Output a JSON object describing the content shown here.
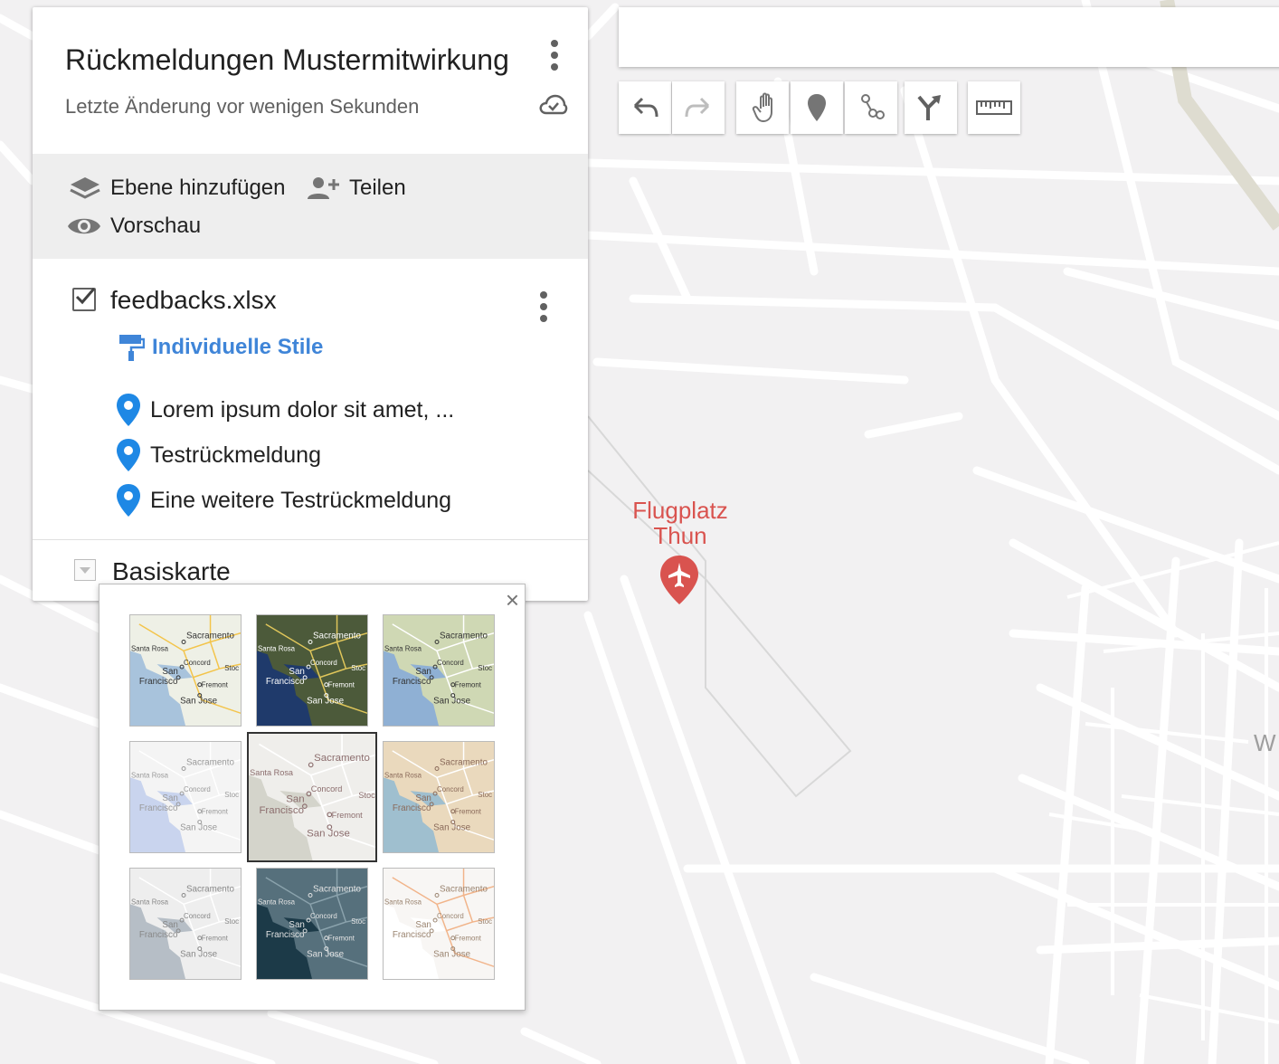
{
  "map": {
    "place_label": "Flugplatz\nThun",
    "place_label_line1": "Flugplatz",
    "place_label_line2": "Thun",
    "edge_label": "W",
    "colors": {
      "background": "#f2f1f2",
      "roads": "#ffffff",
      "airport_red": "#d9534f",
      "pin_blue": "#1e88e5"
    }
  },
  "panel": {
    "title": "Rückmeldungen Mustermitwirkung",
    "last_edit": "Letzte Änderung vor wenigen Sekunden",
    "actions": {
      "add_layer": "Ebene hinzufügen",
      "share": "Teilen",
      "preview": "Vorschau"
    },
    "layer": {
      "name": "feedbacks.xlsx",
      "checked": true,
      "styles_link": "Individuelle Stile",
      "features": [
        {
          "label": "Lorem ipsum dolor sit amet, ..."
        },
        {
          "label": "Testrückmeldung"
        },
        {
          "label": "Eine weitere Testrückmeldung"
        }
      ]
    },
    "basemap_label": "Basiskarte"
  },
  "toolbar": {
    "tools": [
      "undo-icon",
      "redo-icon",
      "hand-icon",
      "marker-icon",
      "line-icon",
      "directions-icon",
      "ruler-icon"
    ]
  },
  "basemap_popup": {
    "close_label": "×",
    "selected_index": 4,
    "thumb_labels": [
      "Sacramento",
      "Santa Rosa",
      "Concord",
      "San",
      "Francisco",
      "Stoc",
      "Fremont",
      "San Jose"
    ],
    "thumbs": [
      {
        "land": "#eef0e6",
        "water": "#a8c3dc",
        "roads": "#f3c44a",
        "text": "#333333"
      },
      {
        "land": "#4c5a3a",
        "water": "#1f3a6b",
        "roads": "#e0c65a",
        "text": "#ffffff"
      },
      {
        "land": "#cfd8b4",
        "water": "#8fb0d4",
        "roads": "#ffffff",
        "text": "#333333"
      },
      {
        "land": "#f4f4f4",
        "water": "#c9d4ee",
        "roads": "#ffffff",
        "text": "#9a9a9a"
      },
      {
        "land": "#efeeeb",
        "water": "#d4d4cb",
        "roads": "#ffffff",
        "text": "#8c6e6e"
      },
      {
        "land": "#ead9bd",
        "water": "#9fbfcf",
        "roads": "#ffffff",
        "text": "#8a6a5a"
      },
      {
        "land": "#eeeeee",
        "water": "#b6bec6",
        "roads": "#ffffff",
        "text": "#888888"
      },
      {
        "land": "#56707c",
        "water": "#1c3a48",
        "roads": "#8aa2ac",
        "text": "#e4e4e4"
      },
      {
        "land": "#f8f6f4",
        "water": "#ffffff",
        "roads": "#f1b48a",
        "text": "#9a8470"
      }
    ]
  }
}
